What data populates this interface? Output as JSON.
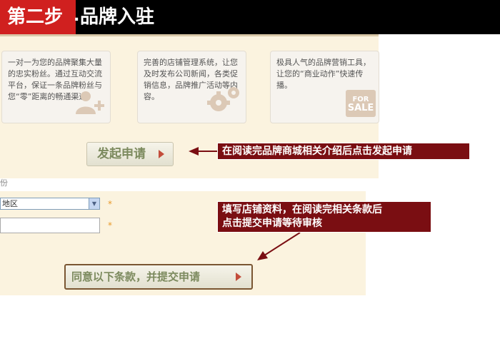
{
  "header": {
    "step": "第二步",
    "separator": ".",
    "title": "品牌入驻"
  },
  "features": [
    {
      "text": "一对一为您的品牌聚集大量的忠实粉丝。通过互动交流平台，保证一条品牌粉丝与您“零”距离的畅通渠道。",
      "icon": "add-user-icon"
    },
    {
      "text": "完善的店铺管理系统，让您及时发布公司新闻，各类促销信息，品牌推广活动等内容。",
      "icon": "gears-icon"
    },
    {
      "text": "极具人气的品牌营销工具，让您的“商业动作”快速传播。",
      "icon": "for-sale-sign-icon",
      "sign_top": "FOR",
      "sign_bottom": "SALE"
    }
  ],
  "apply_button_label": "发起申请",
  "form": {
    "row_label": "份",
    "region_value": "地区",
    "required_mark": "*"
  },
  "agree_button_label": "同意以下条款，并提交申请",
  "annotations": {
    "callout_1": "在阅读完品牌商城相关介绍后点击发起申请",
    "callout_2_line1": "填写店铺资料，在阅读完相关条款后",
    "callout_2_line2": "点击提交申请等待审核"
  },
  "colors": {
    "step_bg": "#d0201f",
    "header_bg": "#000000",
    "panel_bg": "#fbf3df",
    "callout_bg": "#7a0e12",
    "button_text": "#7c8a5e",
    "arrow": "#7a0e12"
  }
}
